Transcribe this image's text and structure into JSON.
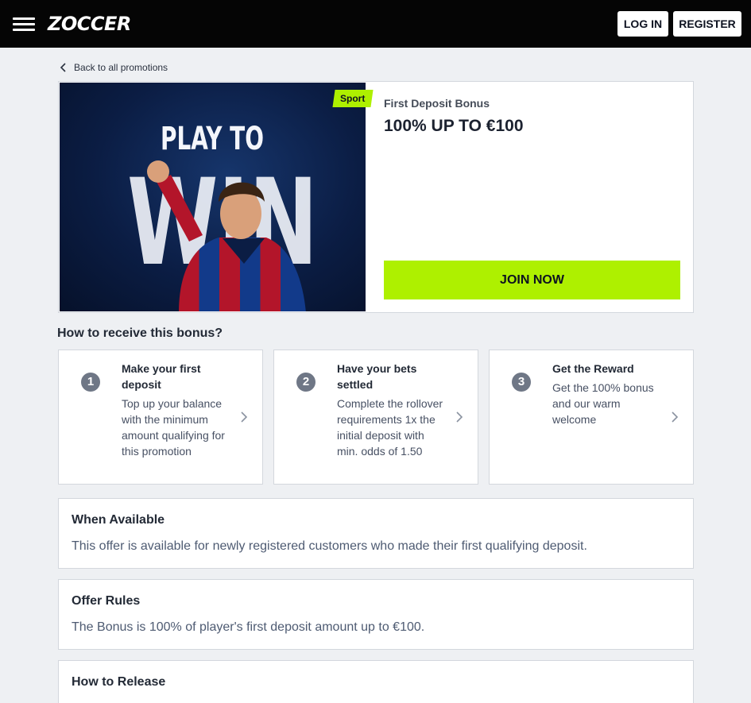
{
  "header": {
    "logo": "ZOCCER",
    "login_label": "LOG IN",
    "register_label": "REGISTER"
  },
  "back_link": "Back to all promotions",
  "promo": {
    "badge": "Sport",
    "subtitle": "First Deposit Bonus",
    "title": "100% UP TO €100",
    "image_text_top": "PLAY TO",
    "image_text_bottom": "WIN",
    "cta": "JOIN NOW"
  },
  "how_to": {
    "heading": "How to receive this bonus?",
    "steps": [
      {
        "number": "1",
        "title": "Make your first deposit",
        "text": "Top up your balance with the minimum amount qualifying for this promotion"
      },
      {
        "number": "2",
        "title": "Have your bets settled",
        "text": "Complete the rollover requirements 1x the initial deposit with min. odds of 1.50"
      },
      {
        "number": "3",
        "title": "Get the Reward",
        "text": "Get the 100% bonus and our warm welcome"
      }
    ]
  },
  "sections": [
    {
      "title": "When Available",
      "text": "This offer is available for newly registered customers who made their first qualifying deposit."
    },
    {
      "title": "Offer Rules",
      "text": "The Bonus is 100% of player's first deposit amount up to €100."
    },
    {
      "title": "How to Release",
      "text": ""
    }
  ],
  "colors": {
    "accent": "#aef000",
    "topbar": "#050505",
    "background": "#eef0f3"
  }
}
